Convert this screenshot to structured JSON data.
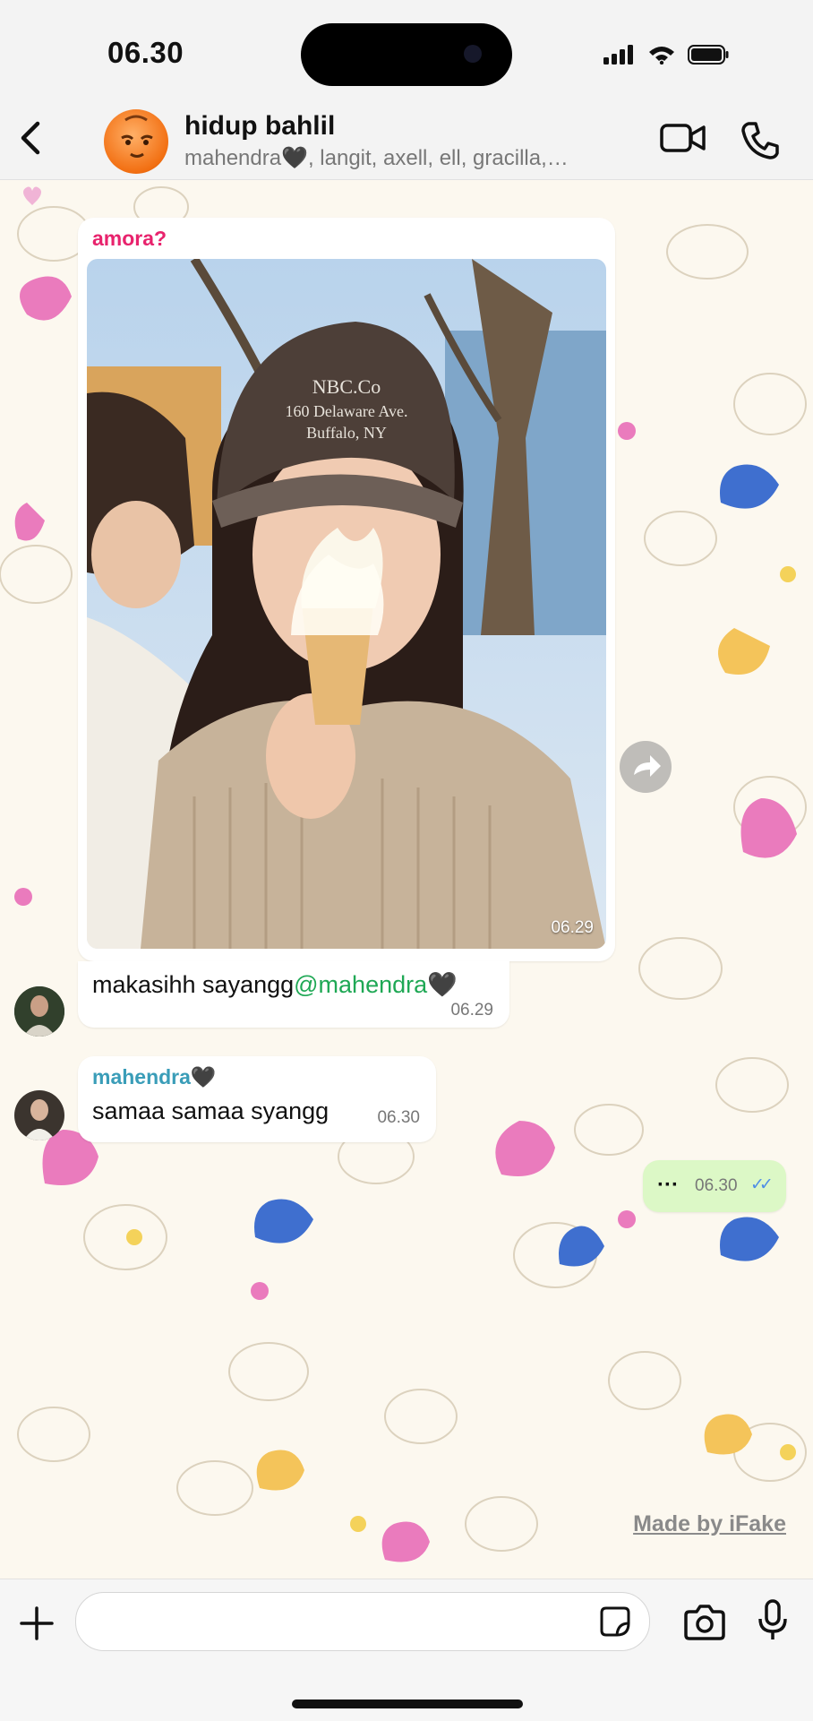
{
  "status_bar": {
    "time": "06.30"
  },
  "header": {
    "title": "hidup bahlil",
    "members": "mahendra🖤, langit, axell, ell, gracilla,…"
  },
  "messages": [
    {
      "sender": "amora?",
      "sender_color": "#e8236d",
      "type": "photo",
      "time": "06.29"
    },
    {
      "text_prefix": "makasihh sayangg",
      "mention": "@mahendra🖤",
      "time": "06.29"
    },
    {
      "sender": "mahendra🖤",
      "sender_color": "#3a9db8",
      "text": "samaa samaa syangg",
      "time": "06.30"
    },
    {
      "text": "···",
      "time": "06.30",
      "read_ticks": "✓✓"
    }
  ],
  "watermark": "Made by iFake",
  "input": {
    "placeholder": ""
  },
  "colors": {
    "outgoing_bubble": "#dcf8c6",
    "accent": "#1fa855",
    "read_ticks": "#4f8ee6"
  }
}
